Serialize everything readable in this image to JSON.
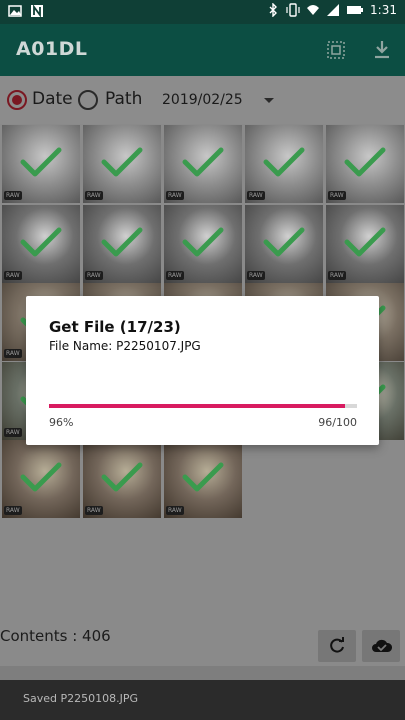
{
  "status_bar": {
    "time": "1:31"
  },
  "app_bar": {
    "title": "A01DL"
  },
  "filter": {
    "options": [
      {
        "label": "Date",
        "selected": true
      },
      {
        "label": "Path",
        "selected": false
      }
    ],
    "date_value": "2019/02/25"
  },
  "raw_badge": "RAW",
  "dialog": {
    "title": "Get File (17/23)",
    "subtitle": "File Name: P2250107.JPG",
    "progress_percent_label": "96%",
    "progress_count_label": "96/100",
    "progress_fraction": 0.96
  },
  "contents_label": "Contents : 406",
  "toast": "Saved P2250108.JPG",
  "colors": {
    "primary": "#0c4e43",
    "accent": "#d81b60",
    "check": "#3a9b4e"
  }
}
